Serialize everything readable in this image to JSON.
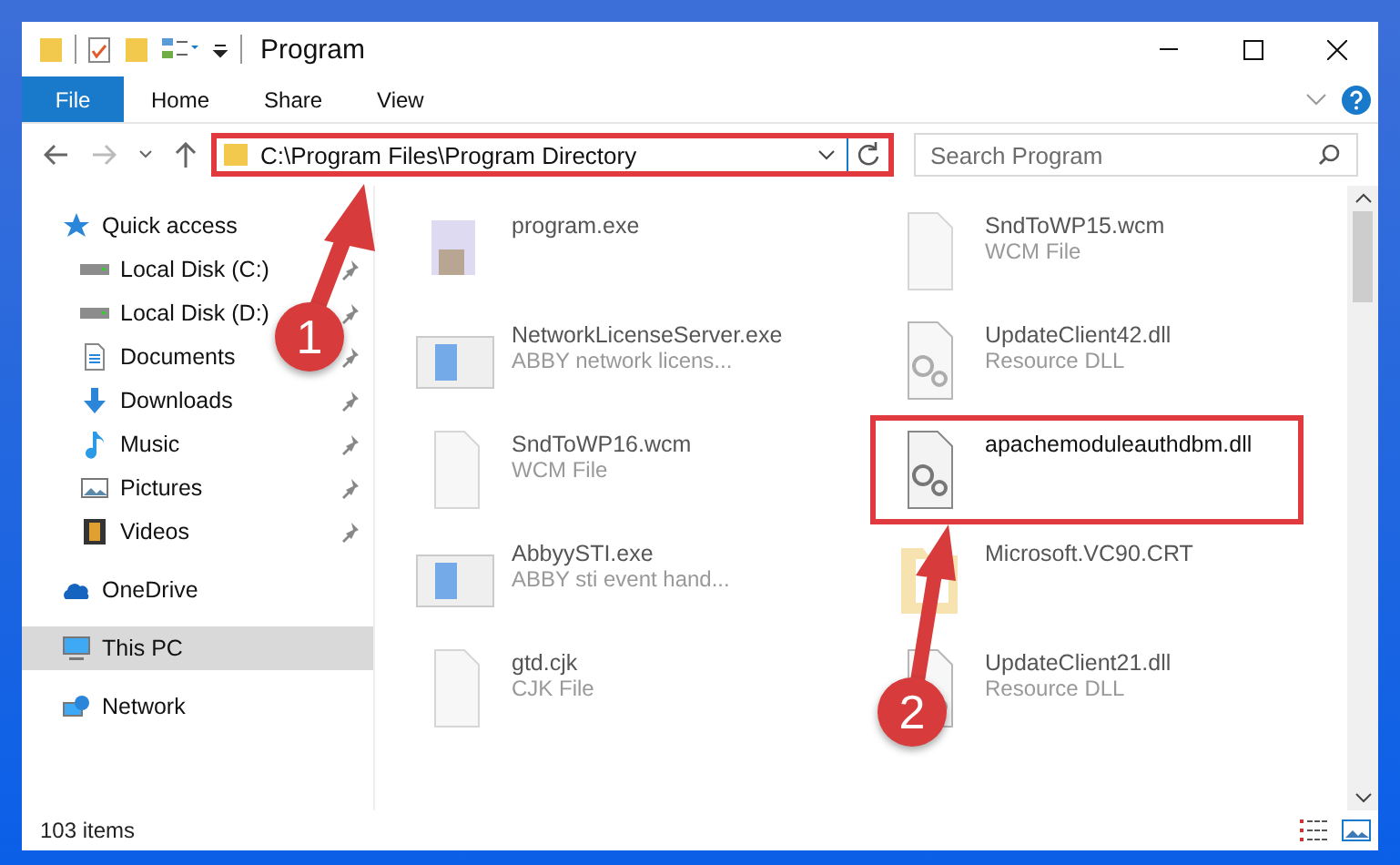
{
  "window": {
    "title": "Program"
  },
  "ribbon": {
    "file_tab": "File",
    "tabs": [
      {
        "label": "Home"
      },
      {
        "label": "Share"
      },
      {
        "label": "View"
      }
    ]
  },
  "address": {
    "path": "C:\\Program Files\\Program Directory",
    "highlighted": true,
    "search_placeholder": "Search Program"
  },
  "sidebar": {
    "items": [
      {
        "label": "Quick access",
        "kind": "star",
        "selected": false,
        "children": [
          {
            "label": "Local Disk (C:)",
            "kind": "drive",
            "pinned": true
          },
          {
            "label": "Local Disk (D:)",
            "kind": "drive",
            "pinned": true
          },
          {
            "label": "Documents",
            "kind": "document",
            "pinned": true
          },
          {
            "label": "Downloads",
            "kind": "download",
            "pinned": true
          },
          {
            "label": "Music",
            "kind": "music",
            "pinned": true
          },
          {
            "label": "Pictures",
            "kind": "picture",
            "pinned": true
          },
          {
            "label": "Videos",
            "kind": "video",
            "pinned": true
          }
        ]
      },
      {
        "label": "OneDrive",
        "kind": "cloud",
        "selected": false
      },
      {
        "label": "This PC",
        "kind": "computer",
        "selected": true
      },
      {
        "label": "Network",
        "kind": "network",
        "selected": false
      }
    ]
  },
  "files": [
    {
      "name": "program.exe",
      "kind": "exe",
      "blurred": true,
      "highlighted": false
    },
    {
      "name": "SndToWP15.wcm",
      "type": "WCM File",
      "kind": "blank",
      "blurred": true,
      "highlighted": false
    },
    {
      "name": "NetworkLicenseServer.exe",
      "type": "ABBY network licens...",
      "kind": "app",
      "blurred": true,
      "highlighted": false
    },
    {
      "name": "UpdateClient42.dll",
      "type": "Resource DLL",
      "kind": "dll",
      "blurred": true,
      "highlighted": false
    },
    {
      "name": "SndToWP16.wcm",
      "type": "WCM File",
      "kind": "blank",
      "blurred": true,
      "highlighted": false
    },
    {
      "name": "apachemoduleauthdbm.dll",
      "kind": "dll",
      "blurred": false,
      "highlighted": true
    },
    {
      "name": "AbbyySTI.exe",
      "type": "ABBY sti event hand...",
      "kind": "app",
      "blurred": true,
      "highlighted": false
    },
    {
      "name": "Microsoft.VC90.CRT",
      "kind": "folder",
      "blurred": true,
      "highlighted": false
    },
    {
      "name": "gtd.cjk",
      "type": "CJK File",
      "kind": "blank",
      "blurred": true,
      "highlighted": false
    },
    {
      "name": "UpdateClient21.dll",
      "type": "Resource DLL",
      "kind": "dll",
      "blurred": true,
      "highlighted": false
    }
  ],
  "status_bar": {
    "count": "103 items"
  },
  "steps": [
    {
      "label": "1"
    },
    {
      "label": "2"
    }
  ]
}
